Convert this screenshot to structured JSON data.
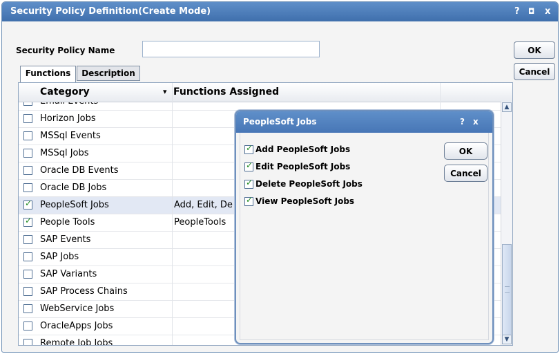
{
  "window": {
    "title": "Security Policy Definition(Create Mode)",
    "help": "?",
    "maximize": "◘",
    "close": "x"
  },
  "form": {
    "policy_name_label": "Security Policy Name",
    "policy_name_value": "",
    "ok_label": "OK",
    "cancel_label": "Cancel"
  },
  "tabs": [
    {
      "label": "Functions",
      "active": true
    },
    {
      "label": "Description",
      "active": false
    }
  ],
  "grid": {
    "columns": [
      "Category",
      "Functions Assigned"
    ],
    "sort_indicator": "▾",
    "rows": [
      {
        "category": "Email Events",
        "functions": "",
        "checked": false
      },
      {
        "category": "Horizon Jobs",
        "functions": "",
        "checked": false
      },
      {
        "category": "MSSql Events",
        "functions": "",
        "checked": false
      },
      {
        "category": "MSSql Jobs",
        "functions": "",
        "checked": false
      },
      {
        "category": "Oracle DB Events",
        "functions": "",
        "checked": false
      },
      {
        "category": "Oracle DB Jobs",
        "functions": "",
        "checked": false
      },
      {
        "category": "PeopleSoft Jobs",
        "functions": "Add, Edit, De",
        "checked": true,
        "selected": true
      },
      {
        "category": "People Tools",
        "functions": "PeopleTools",
        "checked": true
      },
      {
        "category": "SAP Events",
        "functions": "",
        "checked": false
      },
      {
        "category": "SAP Jobs",
        "functions": "",
        "checked": false
      },
      {
        "category": "SAP Variants",
        "functions": "",
        "checked": false
      },
      {
        "category": "SAP Process Chains",
        "functions": "",
        "checked": false
      },
      {
        "category": "WebService Jobs",
        "functions": "",
        "checked": false
      },
      {
        "category": "OracleApps Jobs",
        "functions": "",
        "checked": false
      },
      {
        "category": "Remote Job Jobs",
        "functions": "",
        "checked": false
      }
    ]
  },
  "dialog": {
    "title": "PeopleSoft Jobs",
    "help": "?",
    "close": "x",
    "ok_label": "OK",
    "cancel_label": "Cancel",
    "permissions": [
      {
        "label": "Add PeopleSoft Jobs",
        "checked": true
      },
      {
        "label": "Edit PeopleSoft Jobs",
        "checked": true
      },
      {
        "label": "Delete PeopleSoft Jobs",
        "checked": true
      },
      {
        "label": "View PeopleSoft Jobs",
        "checked": true
      }
    ]
  },
  "colors": {
    "titlebar": "#4f7fbd",
    "check": "#1f8a1f",
    "selected_row": "#e2e8f4"
  }
}
